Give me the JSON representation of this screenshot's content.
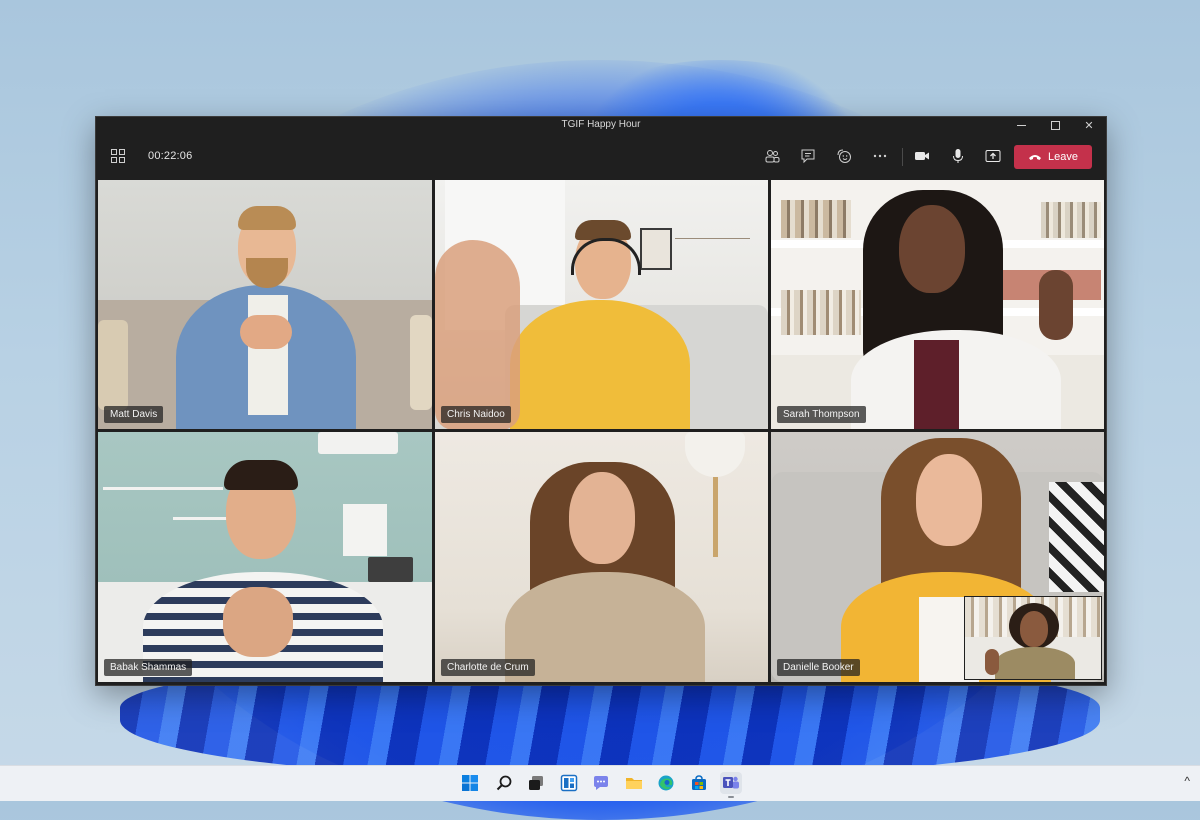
{
  "window": {
    "title": "TGIF Happy Hour",
    "controls": {
      "minimize": "minimize-icon",
      "maximize": "maximize-icon",
      "close": "close-icon"
    }
  },
  "toolbar": {
    "call_timer": "00:22:06",
    "leave_label": "Leave",
    "leave_color": "#c4314b",
    "icons": [
      "view-layout-icon",
      "participants-icon",
      "chat-icon",
      "reactions-icon",
      "more-options-icon",
      "camera-icon",
      "microphone-icon",
      "share-screen-icon",
      "phone-hangup-icon"
    ]
  },
  "participants": [
    {
      "name": "Matt Davis"
    },
    {
      "name": "Chris Naidoo"
    },
    {
      "name": "Sarah Thompson"
    },
    {
      "name": "Babak Shammas"
    },
    {
      "name": "Charlotte de Crum"
    },
    {
      "name": "Danielle Booker"
    }
  ],
  "taskbar": {
    "icons": [
      "windows-start-icon",
      "search-icon",
      "task-view-icon",
      "widgets-icon",
      "teams-chat-icon",
      "file-explorer-icon",
      "edge-browser-icon",
      "microsoft-store-icon",
      "teams-app-icon"
    ],
    "tray_chevron": "^",
    "accent": "#0067c0"
  }
}
